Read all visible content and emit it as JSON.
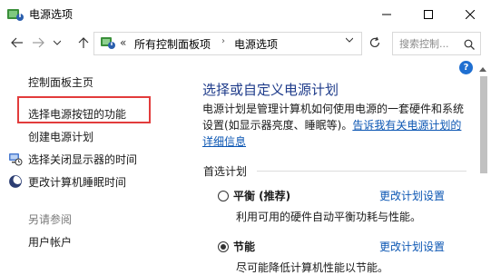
{
  "window": {
    "title": "电源选项",
    "minimize_icon": "minimize-icon",
    "maximize_icon": "maximize-icon",
    "close_icon": "close-icon"
  },
  "navigation": {
    "back_icon": "arrow-left-icon",
    "forward_icon": "arrow-right-icon",
    "recent_icon": "chevron-down-icon",
    "up_icon": "arrow-up-icon",
    "breadcrumb_prefix": "«",
    "breadcrumb": [
      "所有控制面板项",
      "电源选项"
    ],
    "breadcrumb_separator": "›",
    "search_placeholder": "搜索控制...",
    "refresh_icon": "refresh-icon",
    "search_icon": "search-icon"
  },
  "help": {
    "label": "?"
  },
  "sidebar": {
    "home_link": "控制面板主页",
    "links": [
      {
        "label": "选择电源按钮的功能",
        "highlighted": true
      },
      {
        "label": "创建电源计划",
        "icon": null
      },
      {
        "label": "选择关闭显示器的时间",
        "icon": "monitor-clock-icon"
      },
      {
        "label": "更改计算机睡眠时间",
        "icon": "moon-icon"
      }
    ],
    "see_also_heading": "另请参阅",
    "see_also_links": [
      "用户帐户"
    ]
  },
  "main": {
    "title": "选择或自定义电源计划",
    "description": "电源计划是管理计算机如何使用电源的一套硬件和系统设置(如显示器亮度、睡眠等)。",
    "description_link": "告诉我有关电源计划的详细信息",
    "section_label": "首选计划",
    "plans": [
      {
        "name": "平衡 (推荐)",
        "description": "利用可用的硬件自动平衡功耗与性能。",
        "link": "更改计划设置",
        "selected": false
      },
      {
        "name": "节能",
        "description": "尽可能降低计算机性能以节能。",
        "link": "更改计划设置",
        "selected": true
      }
    ]
  },
  "colors": {
    "accent_link": "#0b56b3",
    "title_blue": "#1e3b8a",
    "highlight_red": "#e23c3c"
  }
}
